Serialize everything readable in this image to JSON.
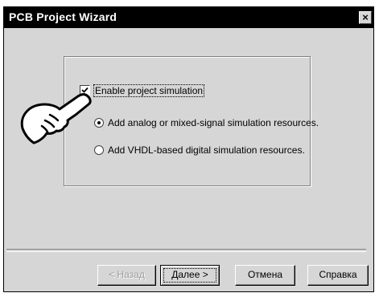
{
  "window": {
    "title": "PCB Project Wizard",
    "close_glyph": "×"
  },
  "options": {
    "enable_simulation_label": "Enable project simulation",
    "enable_simulation_checked": true,
    "radio_analog_label": "Add analog or mixed-signal simulation resources.",
    "radio_analog_selected": true,
    "radio_vhdl_label": "Add VHDL-based digital simulation resources.",
    "radio_vhdl_selected": false
  },
  "buttons": {
    "back_label": "< Назад",
    "next_label": "Далее >",
    "cancel_label": "Отмена",
    "help_label": "Справка"
  },
  "colors": {
    "titlebar": "#000000",
    "dialog_bg": "#d6d6d6",
    "disabled_text": "#9a9a9a"
  },
  "icons": {
    "cursor": "hand-pointer-icon",
    "check": "checkmark-icon"
  }
}
